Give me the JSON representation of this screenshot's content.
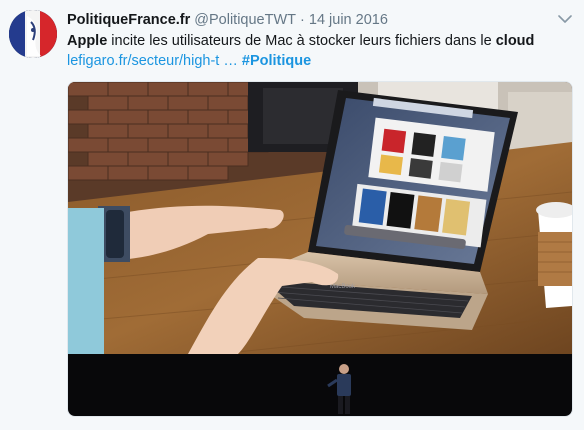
{
  "tweet": {
    "author_name": "PolitiqueFrance.fr",
    "author_handle": "@PolitiqueTWT",
    "separator": "·",
    "date": "14 juin 2016",
    "text_part1": "Apple",
    "text_part2": " incite les utilisateurs de Mac à stocker leurs fichiers dans le ",
    "text_part3": "cloud",
    "link": "lefigaro.fr/secteur/high-t …",
    "hashtag": "#Politique"
  },
  "icons": {
    "menu_caret": "chevron-down-icon",
    "avatar": "french-flag-avatar"
  },
  "media": {
    "keyboard_brand": "MacBook",
    "subject": "photo-laptop-on-table-with-keynote-speaker-strip"
  },
  "colors": {
    "link": "#1b95e0",
    "text": "#14171a",
    "muted": "#657786",
    "background": "#f5f8fa"
  }
}
